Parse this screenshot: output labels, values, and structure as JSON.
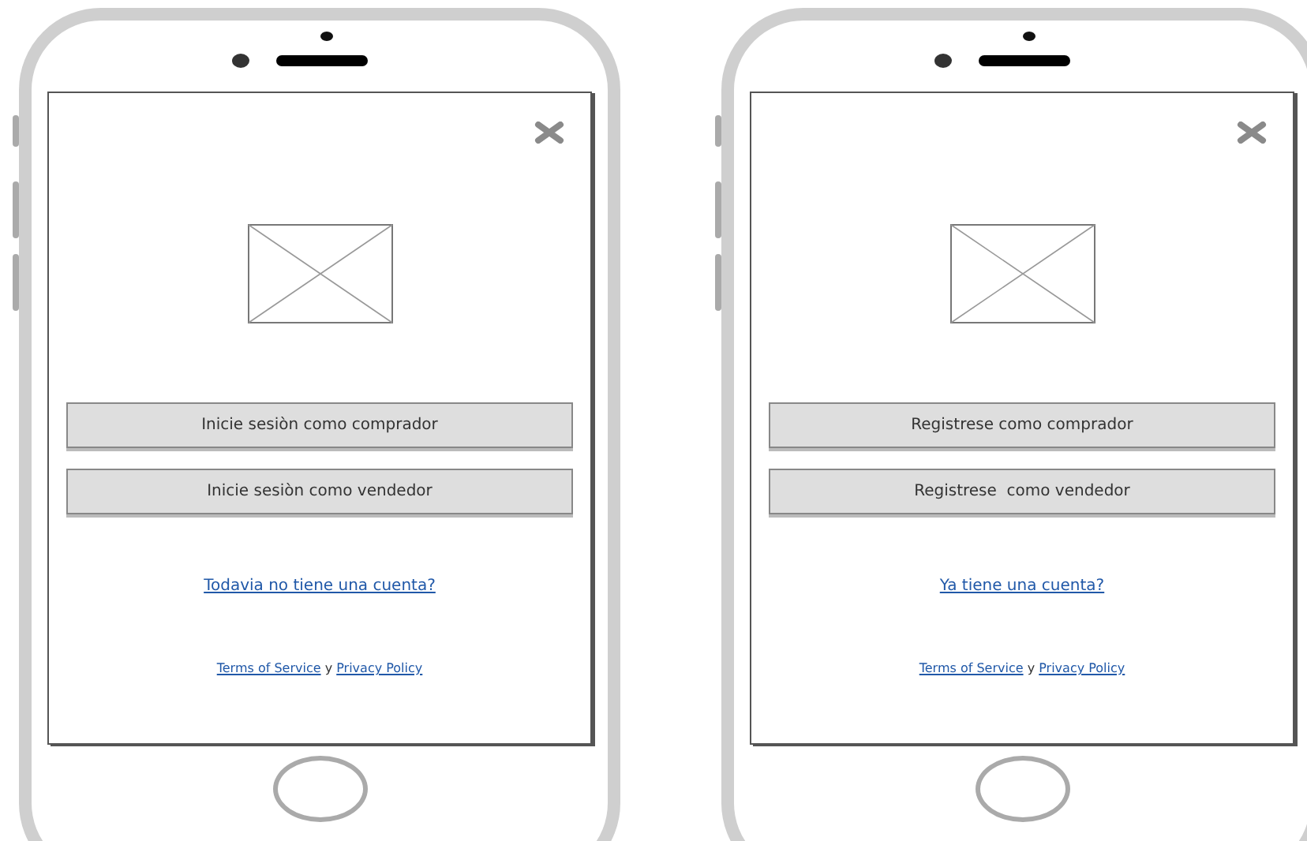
{
  "phones": [
    {
      "buttons": [
        "Inicie sesiòn como comprador",
        "Inicie sesiòn como vendedor"
      ],
      "account_link": "Todavia no tiene una cuenta?",
      "legal": {
        "terms": "Terms of Service",
        "conjunction": "y",
        "privacy": "Privacy Policy"
      }
    },
    {
      "buttons": [
        "Registrese como comprador",
        "Registrese  como vendedor"
      ],
      "account_link": "Ya tiene una cuenta?",
      "legal": {
        "terms": "Terms of Service",
        "conjunction": "y",
        "privacy": "Privacy Policy"
      }
    }
  ]
}
